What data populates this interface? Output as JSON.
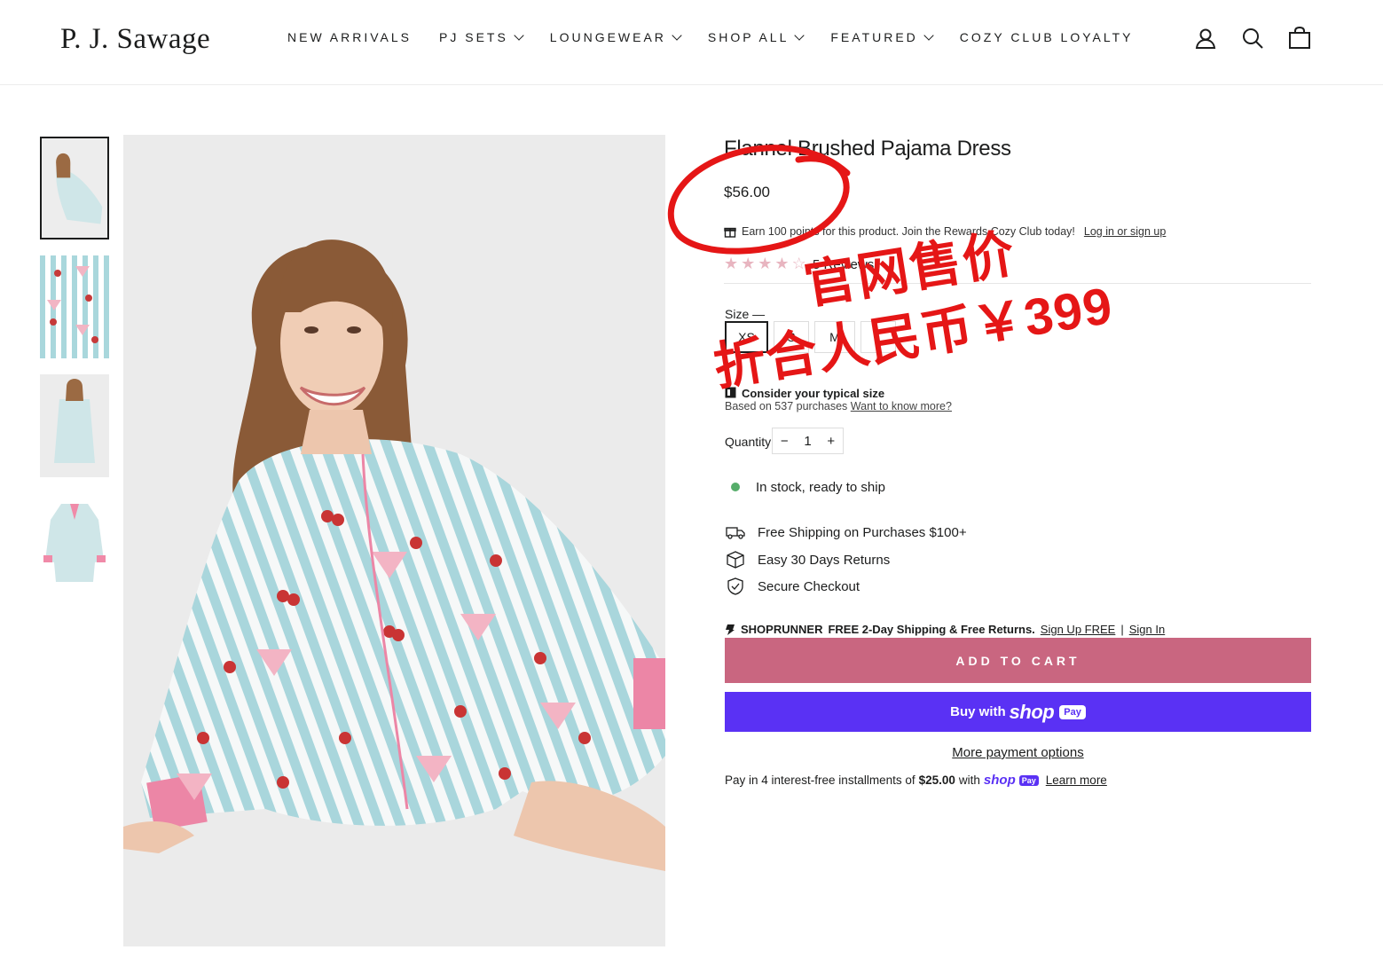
{
  "header": {
    "logo": "P. J. Sawage",
    "nav": [
      {
        "label": "NEW ARRIVALS",
        "dropdown": false
      },
      {
        "label": "PJ SETS",
        "dropdown": true
      },
      {
        "label": "LOUNGEWEAR",
        "dropdown": true
      },
      {
        "label": "SHOP ALL",
        "dropdown": true
      },
      {
        "label": "FEATURED",
        "dropdown": true
      },
      {
        "label": "COZY CLUB LOYALTY",
        "dropdown": false
      }
    ],
    "icons": [
      "account-icon",
      "search-icon",
      "cart-icon"
    ]
  },
  "product": {
    "title": "Flannel Brushed Pajama Dress",
    "price": "$56.00",
    "rewards_text": "Earn 100 points for this product. Join the Rewards Cozy Club today!",
    "rewards_link": "Log in or sign up",
    "rating": 4.5,
    "reviews": "5 Reviews",
    "size_label": "Size —",
    "sizes": [
      "XS",
      "S",
      "M",
      "L"
    ],
    "selected_size": "XS",
    "fit_title": "Consider your typical size",
    "fit_sub": "Based on 537 purchases",
    "fit_link": "Want to know more?",
    "quantity_label": "Quantity",
    "quantity": "1",
    "minus": "−",
    "plus": "+",
    "stock": "In stock, ready to ship",
    "features": [
      {
        "icon": "truck-icon",
        "text": "Free Shipping on Purchases $100+"
      },
      {
        "icon": "box-icon",
        "text": "Easy 30 Days Returns"
      },
      {
        "icon": "shield-check-icon",
        "text": "Secure Checkout"
      }
    ],
    "shoprunner": {
      "brand": "SHOPRUNNER",
      "offer": "FREE 2-Day Shipping & Free Returns.",
      "signup": "Sign Up FREE",
      "separator": "|",
      "signin": "Sign In"
    },
    "add_to_cart": "ADD TO CART",
    "shoppay": {
      "buy_with": "Buy with",
      "shop": "shop",
      "pay": "Pay"
    },
    "more_payment": "More payment options",
    "installments": {
      "prefix": "Pay in 4 interest-free installments of",
      "amount": "$25.00",
      "with": "with",
      "learn_more": "Learn more"
    }
  },
  "annotation": {
    "line1": "官网售价",
    "line2": "折合人民币￥399",
    "color": "#e51616"
  },
  "colors": {
    "add_to_cart": "#c96680",
    "shop_pay": "#5a31f4",
    "stock_dot": "#56ad6a"
  }
}
